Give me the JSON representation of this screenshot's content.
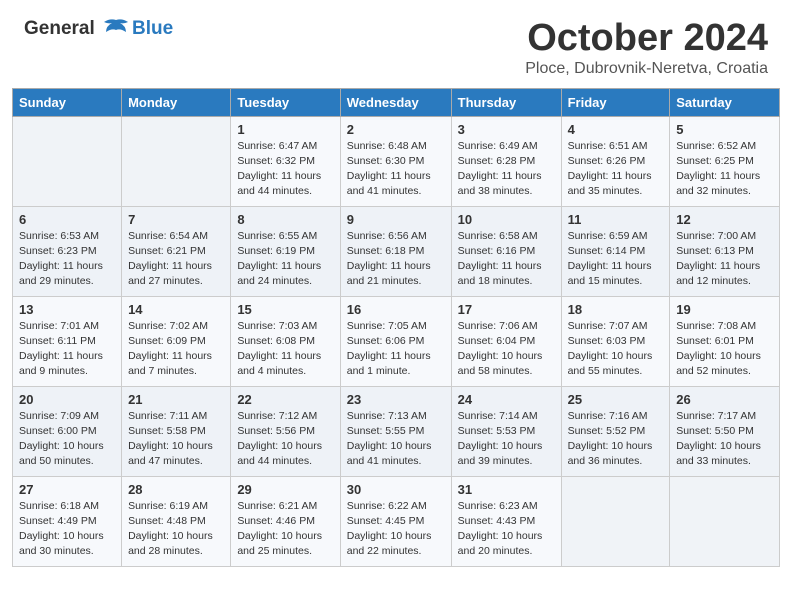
{
  "header": {
    "logo_line1": "General",
    "logo_line2": "Blue",
    "month": "October 2024",
    "location": "Ploce, Dubrovnik-Neretva, Croatia"
  },
  "weekdays": [
    "Sunday",
    "Monday",
    "Tuesday",
    "Wednesday",
    "Thursday",
    "Friday",
    "Saturday"
  ],
  "weeks": [
    [
      {
        "day": "",
        "info": ""
      },
      {
        "day": "",
        "info": ""
      },
      {
        "day": "1",
        "info": "Sunrise: 6:47 AM\nSunset: 6:32 PM\nDaylight: 11 hours and 44 minutes."
      },
      {
        "day": "2",
        "info": "Sunrise: 6:48 AM\nSunset: 6:30 PM\nDaylight: 11 hours and 41 minutes."
      },
      {
        "day": "3",
        "info": "Sunrise: 6:49 AM\nSunset: 6:28 PM\nDaylight: 11 hours and 38 minutes."
      },
      {
        "day": "4",
        "info": "Sunrise: 6:51 AM\nSunset: 6:26 PM\nDaylight: 11 hours and 35 minutes."
      },
      {
        "day": "5",
        "info": "Sunrise: 6:52 AM\nSunset: 6:25 PM\nDaylight: 11 hours and 32 minutes."
      }
    ],
    [
      {
        "day": "6",
        "info": "Sunrise: 6:53 AM\nSunset: 6:23 PM\nDaylight: 11 hours and 29 minutes."
      },
      {
        "day": "7",
        "info": "Sunrise: 6:54 AM\nSunset: 6:21 PM\nDaylight: 11 hours and 27 minutes."
      },
      {
        "day": "8",
        "info": "Sunrise: 6:55 AM\nSunset: 6:19 PM\nDaylight: 11 hours and 24 minutes."
      },
      {
        "day": "9",
        "info": "Sunrise: 6:56 AM\nSunset: 6:18 PM\nDaylight: 11 hours and 21 minutes."
      },
      {
        "day": "10",
        "info": "Sunrise: 6:58 AM\nSunset: 6:16 PM\nDaylight: 11 hours and 18 minutes."
      },
      {
        "day": "11",
        "info": "Sunrise: 6:59 AM\nSunset: 6:14 PM\nDaylight: 11 hours and 15 minutes."
      },
      {
        "day": "12",
        "info": "Sunrise: 7:00 AM\nSunset: 6:13 PM\nDaylight: 11 hours and 12 minutes."
      }
    ],
    [
      {
        "day": "13",
        "info": "Sunrise: 7:01 AM\nSunset: 6:11 PM\nDaylight: 11 hours and 9 minutes."
      },
      {
        "day": "14",
        "info": "Sunrise: 7:02 AM\nSunset: 6:09 PM\nDaylight: 11 hours and 7 minutes."
      },
      {
        "day": "15",
        "info": "Sunrise: 7:03 AM\nSunset: 6:08 PM\nDaylight: 11 hours and 4 minutes."
      },
      {
        "day": "16",
        "info": "Sunrise: 7:05 AM\nSunset: 6:06 PM\nDaylight: 11 hours and 1 minute."
      },
      {
        "day": "17",
        "info": "Sunrise: 7:06 AM\nSunset: 6:04 PM\nDaylight: 10 hours and 58 minutes."
      },
      {
        "day": "18",
        "info": "Sunrise: 7:07 AM\nSunset: 6:03 PM\nDaylight: 10 hours and 55 minutes."
      },
      {
        "day": "19",
        "info": "Sunrise: 7:08 AM\nSunset: 6:01 PM\nDaylight: 10 hours and 52 minutes."
      }
    ],
    [
      {
        "day": "20",
        "info": "Sunrise: 7:09 AM\nSunset: 6:00 PM\nDaylight: 10 hours and 50 minutes."
      },
      {
        "day": "21",
        "info": "Sunrise: 7:11 AM\nSunset: 5:58 PM\nDaylight: 10 hours and 47 minutes."
      },
      {
        "day": "22",
        "info": "Sunrise: 7:12 AM\nSunset: 5:56 PM\nDaylight: 10 hours and 44 minutes."
      },
      {
        "day": "23",
        "info": "Sunrise: 7:13 AM\nSunset: 5:55 PM\nDaylight: 10 hours and 41 minutes."
      },
      {
        "day": "24",
        "info": "Sunrise: 7:14 AM\nSunset: 5:53 PM\nDaylight: 10 hours and 39 minutes."
      },
      {
        "day": "25",
        "info": "Sunrise: 7:16 AM\nSunset: 5:52 PM\nDaylight: 10 hours and 36 minutes."
      },
      {
        "day": "26",
        "info": "Sunrise: 7:17 AM\nSunset: 5:50 PM\nDaylight: 10 hours and 33 minutes."
      }
    ],
    [
      {
        "day": "27",
        "info": "Sunrise: 6:18 AM\nSunset: 4:49 PM\nDaylight: 10 hours and 30 minutes."
      },
      {
        "day": "28",
        "info": "Sunrise: 6:19 AM\nSunset: 4:48 PM\nDaylight: 10 hours and 28 minutes."
      },
      {
        "day": "29",
        "info": "Sunrise: 6:21 AM\nSunset: 4:46 PM\nDaylight: 10 hours and 25 minutes."
      },
      {
        "day": "30",
        "info": "Sunrise: 6:22 AM\nSunset: 4:45 PM\nDaylight: 10 hours and 22 minutes."
      },
      {
        "day": "31",
        "info": "Sunrise: 6:23 AM\nSunset: 4:43 PM\nDaylight: 10 hours and 20 minutes."
      },
      {
        "day": "",
        "info": ""
      },
      {
        "day": "",
        "info": ""
      }
    ]
  ]
}
